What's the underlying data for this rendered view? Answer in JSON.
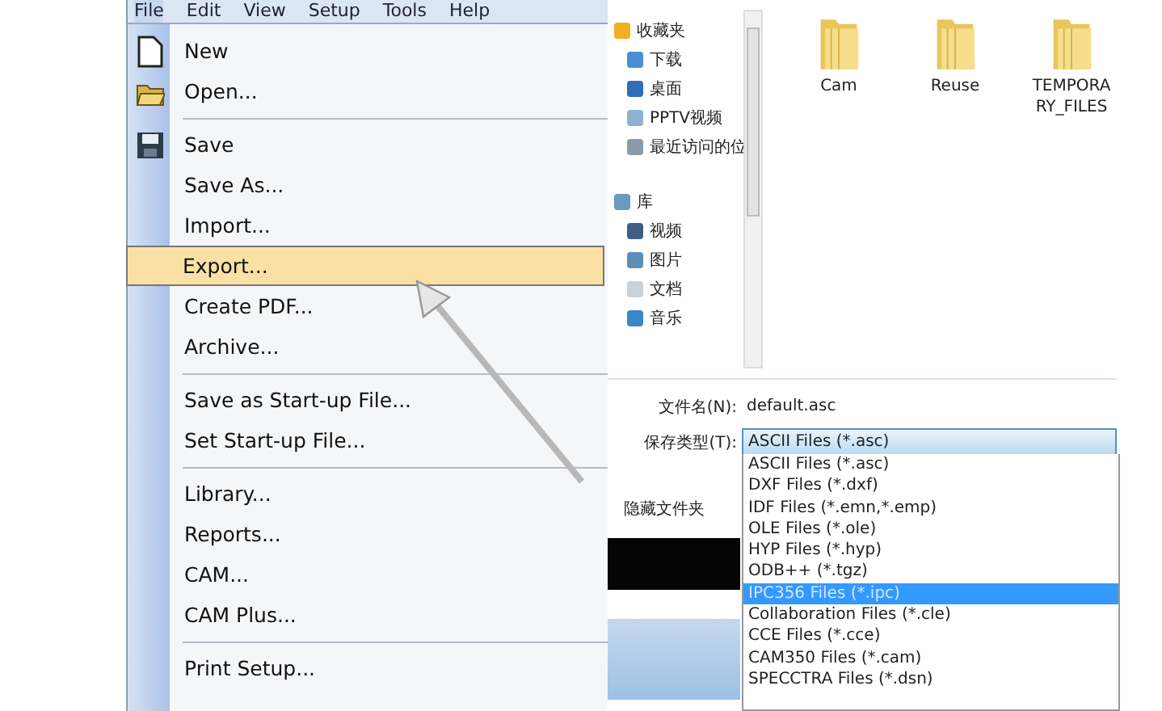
{
  "menu_bar": [
    {
      "label": "File",
      "selected": true
    },
    {
      "label": "Edit",
      "selected": false
    },
    {
      "label": "View",
      "selected": false
    },
    {
      "label": "Setup",
      "selected": false
    },
    {
      "label": "Tools",
      "selected": false
    },
    {
      "label": "Help",
      "selected": false
    }
  ],
  "file_menu": [
    {
      "kind": "item",
      "label": "New",
      "selected": false
    },
    {
      "kind": "item",
      "label": "Open...",
      "selected": false
    },
    {
      "kind": "separator"
    },
    {
      "kind": "item",
      "label": "Save",
      "selected": false
    },
    {
      "kind": "item",
      "label": "Save As...",
      "selected": false
    },
    {
      "kind": "item",
      "label": "Import...",
      "selected": false
    },
    {
      "kind": "item",
      "label": "Export...",
      "selected": true
    },
    {
      "kind": "item",
      "label": "Create PDF...",
      "selected": false
    },
    {
      "kind": "item",
      "label": "Archive...",
      "selected": false
    },
    {
      "kind": "separator"
    },
    {
      "kind": "item",
      "label": "Save as Start-up File...",
      "selected": false
    },
    {
      "kind": "item",
      "label": "Set Start-up File...",
      "selected": false
    },
    {
      "kind": "separator"
    },
    {
      "kind": "item",
      "label": "Library...",
      "selected": false
    },
    {
      "kind": "item",
      "label": "Reports...",
      "selected": false
    },
    {
      "kind": "item",
      "label": "CAM...",
      "selected": false
    },
    {
      "kind": "item",
      "label": "CAM Plus...",
      "selected": false
    },
    {
      "kind": "separator"
    },
    {
      "kind": "item",
      "label": "Print Setup...",
      "selected": false
    }
  ],
  "save_dialog": {
    "nav": [
      {
        "kind": "group",
        "label": "收藏夹"
      },
      {
        "kind": "item",
        "label": "下载"
      },
      {
        "kind": "item",
        "label": "桌面"
      },
      {
        "kind": "item",
        "label": "PPTV视频"
      },
      {
        "kind": "item",
        "label": "最近访问的位"
      },
      {
        "kind": "group",
        "label": "库"
      },
      {
        "kind": "item",
        "label": "视频"
      },
      {
        "kind": "item",
        "label": "图片"
      },
      {
        "kind": "item",
        "label": "文档"
      },
      {
        "kind": "item",
        "label": "音乐"
      }
    ],
    "folders": [
      {
        "name": "Cam"
      },
      {
        "name": "Reuse"
      },
      {
        "name": "TEMPORARY_FILES"
      }
    ],
    "filename_label": "文件名(N):",
    "filename_value": "default.asc",
    "type_label": "保存类型(T):",
    "type_value": "ASCII Files (*.asc)",
    "hide_folders_label": "隐藏文件夹",
    "type_options": [
      {
        "label": "ASCII Files (*.asc)",
        "selected": false
      },
      {
        "label": "DXF Files (*.dxf)",
        "selected": false
      },
      {
        "label": "IDF Files (*.emn,*.emp)",
        "selected": false
      },
      {
        "label": "OLE Files (*.ole)",
        "selected": false
      },
      {
        "label": "HYP Files (*.hyp)",
        "selected": false
      },
      {
        "label": "ODB++ (*.tgz)",
        "selected": false
      },
      {
        "label": "IPC356 Files (*.ipc)",
        "selected": true
      },
      {
        "label": "Collaboration Files (*.cle)",
        "selected": false
      },
      {
        "label": "CCE Files (*.cce)",
        "selected": false
      },
      {
        "label": "CAM350 Files (*.cam)",
        "selected": false
      },
      {
        "label": "SPECCTRA Files (*.dsn)",
        "selected": false
      }
    ]
  }
}
